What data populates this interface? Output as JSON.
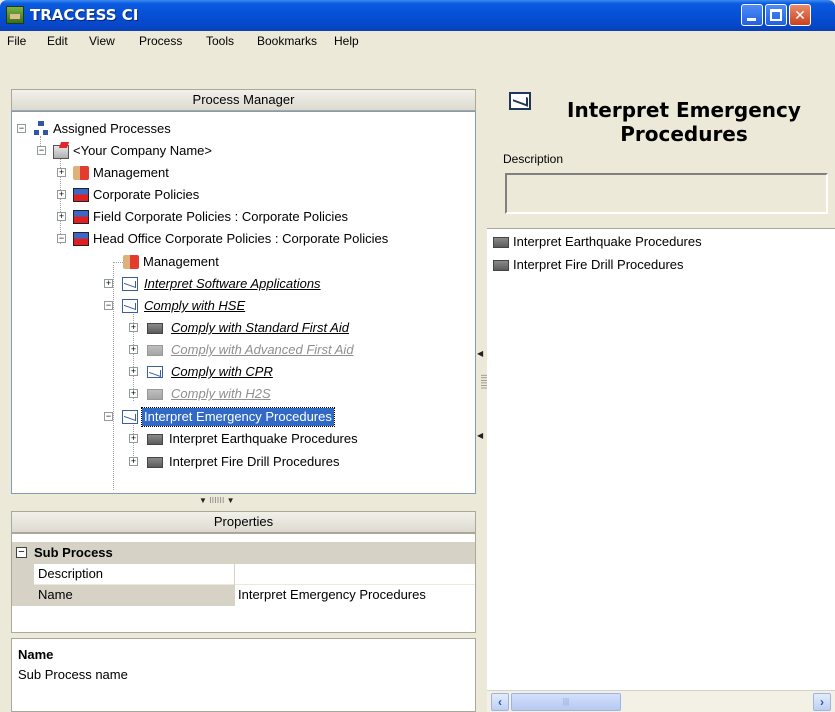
{
  "window": {
    "title": "TRACCESS CI",
    "minimize_icon": "minimize-icon",
    "maximize_icon": "maximize-icon",
    "close_label": "✕"
  },
  "menu": [
    "File",
    "Edit",
    "View",
    "Process",
    "Tools",
    "Bookmarks",
    "Help"
  ],
  "process_manager": {
    "header": "Process Manager",
    "tree": [
      {
        "label": "Assigned Processes",
        "icon": "org-chart-icon"
      },
      {
        "label": "<Your Company Name>",
        "icon": "company-icon"
      },
      {
        "label": "Management",
        "icon": "people-icon"
      },
      {
        "label": "Corporate Policies",
        "icon": "policy-icon"
      },
      {
        "label": "Field Corporate Policies : Corporate Policies",
        "icon": "policy-icon"
      },
      {
        "label": "Head Office Corporate Policies : Corporate Policies",
        "icon": "policy-icon"
      },
      {
        "label": "Management",
        "icon": "people-icon"
      },
      {
        "label": "Interpret Software Applications",
        "icon": "envelope-icon"
      },
      {
        "label": "Comply with HSE",
        "icon": "envelope-icon"
      },
      {
        "label": "Comply with Standard First Aid",
        "icon": "gray-box-icon"
      },
      {
        "label": "Comply with Advanced First Aid",
        "icon": "gray-box-icon"
      },
      {
        "label": "Comply with CPR",
        "icon": "envelope-icon"
      },
      {
        "label": "Comply with H2S",
        "icon": "gray-box-icon"
      },
      {
        "label": "Interpret Emergency Procedures",
        "icon": "envelope-icon",
        "selected": true
      },
      {
        "label": "Interpret Earthquake Procedures",
        "icon": "gray-box-icon"
      },
      {
        "label": "Interpret Fire Drill Procedures",
        "icon": "gray-box-icon"
      }
    ]
  },
  "properties": {
    "header": "Properties",
    "category": "Sub Process",
    "rows": [
      {
        "name": "Description",
        "value": ""
      },
      {
        "name": "Name",
        "value": "Interpret Emergency Procedures"
      }
    ],
    "help_title": "Name",
    "help_text": "Sub Process name"
  },
  "detail": {
    "title": "Interpret Emergency Procedures",
    "description_label": "Description",
    "description_value": "",
    "items": [
      "Interpret Earthquake Procedures",
      "Interpret Fire Drill Procedures"
    ]
  }
}
